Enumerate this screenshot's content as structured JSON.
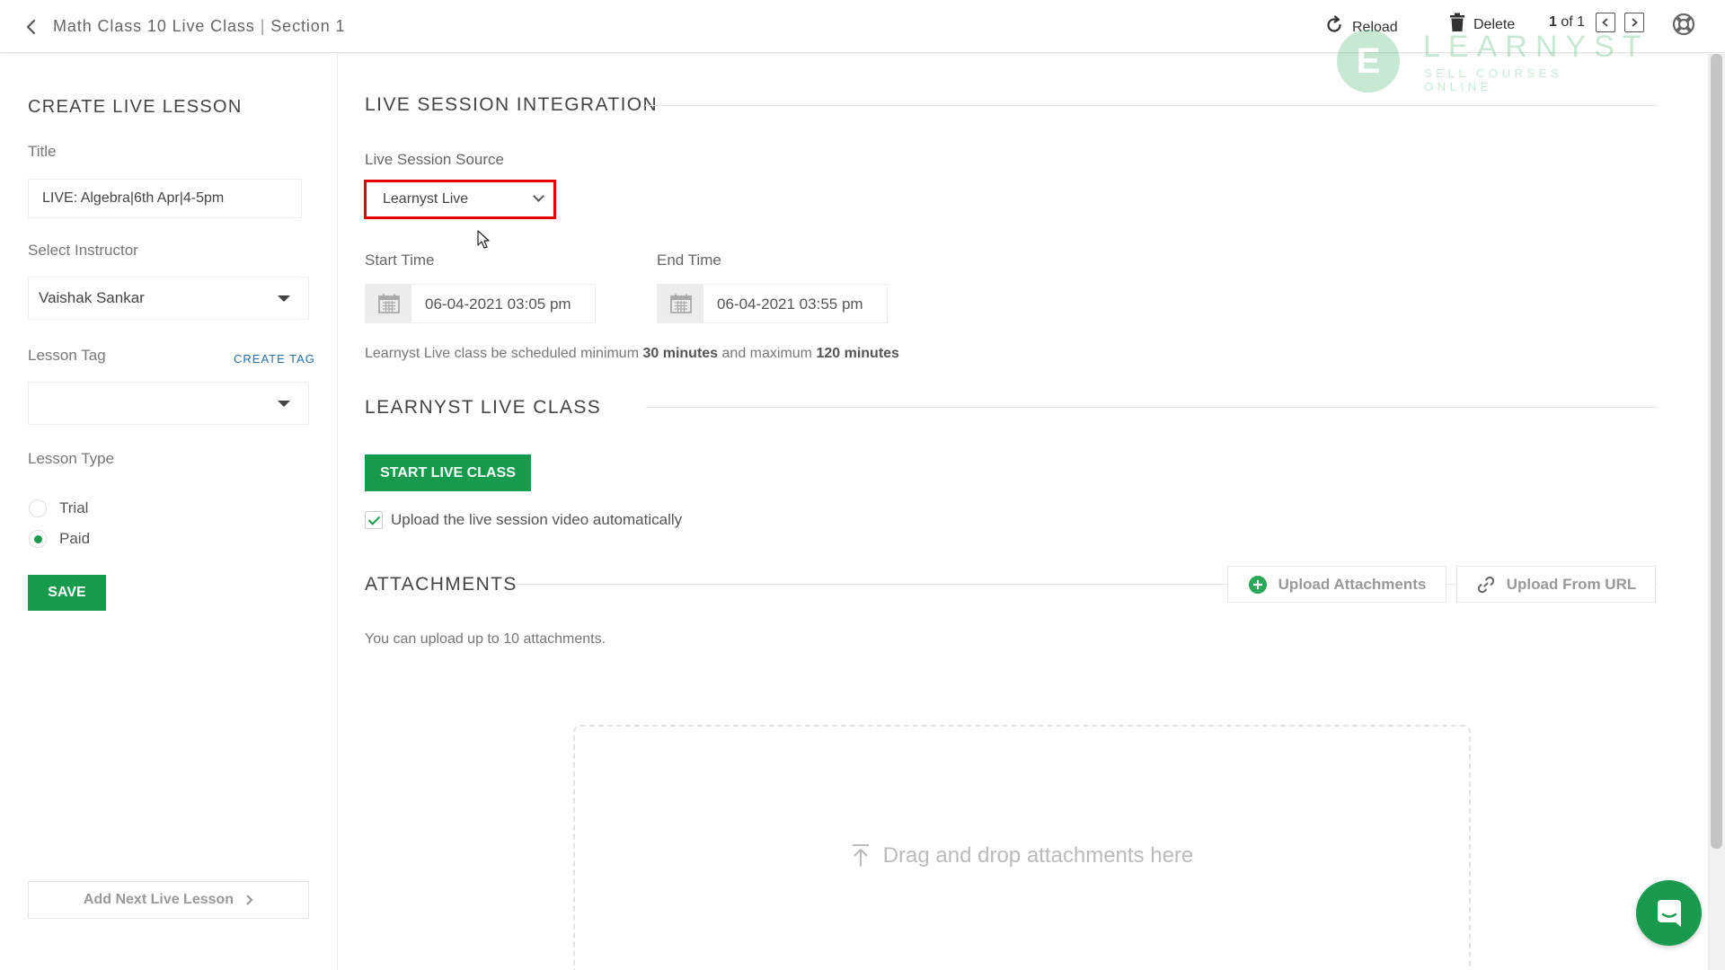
{
  "header": {
    "breadcrumb_course": "Math Class 10 Live Class",
    "breadcrumb_separator": "|",
    "breadcrumb_section": "Section 1",
    "reload_label": "Reload",
    "delete_label": "Delete",
    "pager_current": "1",
    "pager_rest": " of 1"
  },
  "logo": {
    "letter": "E",
    "name": "LEARNYST",
    "tagline": "SELL COURSES ONLINE",
    "color": "#38b060"
  },
  "sidebar": {
    "title": "CREATE LIVE LESSON",
    "title_label": "Title",
    "title_value": "LIVE: Algebra|6th Apr|4-5pm",
    "instructor_label": "Select Instructor",
    "instructor_value": "Vaishak Sankar",
    "tag_label": "Lesson Tag",
    "create_tag": "CREATE TAG",
    "tag_value": "",
    "type_label": "Lesson Type",
    "type_options": [
      "Trial",
      "Paid"
    ],
    "type_selected": "Paid",
    "save_label": "SAVE",
    "add_next_label": "Add Next Live Lesson"
  },
  "integration": {
    "title": "LIVE SESSION INTEGRATION",
    "source_label": "Live Session Source",
    "source_value": "Learnyst Live",
    "start_label": "Start Time",
    "start_value": "06-04-2021 03:05 pm",
    "end_label": "End Time",
    "end_value": "06-04-2021 03:55 pm",
    "note_pre": "Learnyst Live class be scheduled minimum ",
    "note_min": "30 minutes",
    "note_mid": " and maximum ",
    "note_max": "120 minutes"
  },
  "live_class": {
    "title": "LEARNYST LIVE CLASS",
    "start_button": "START LIVE CLASS",
    "auto_upload_label": "Upload the live session video automatically",
    "auto_upload_checked": true
  },
  "attachments": {
    "title": "ATTACHMENTS",
    "upload_button": "Upload Attachments",
    "url_button": "Upload From URL",
    "limit_note": "You can upload up to 10 attachments.",
    "dropzone_text": "Drag and drop attachments here"
  },
  "colors": {
    "accent_green": "#169a4b",
    "highlight_red": "#e00000",
    "link_blue": "#2a6fa8"
  }
}
